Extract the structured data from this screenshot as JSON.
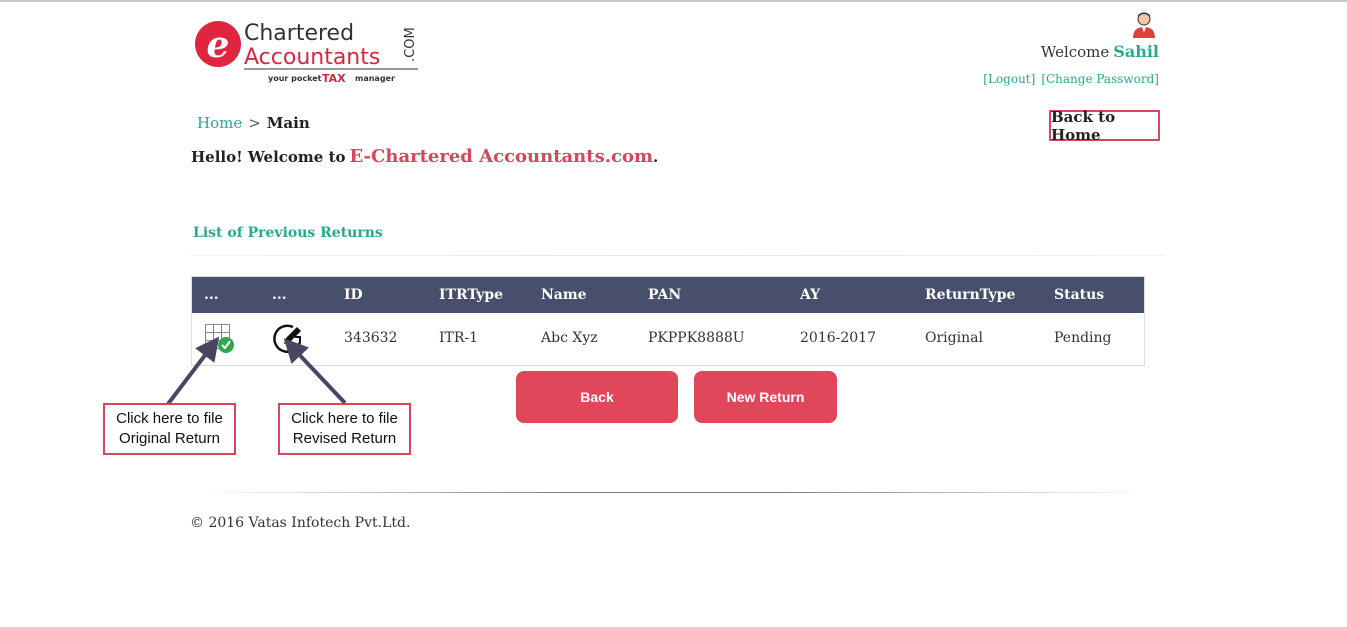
{
  "logo": {
    "letter": "e",
    "line1": "Chartered",
    "line2": "Accountants",
    "dot_com": ".COM",
    "tagline_pre": "your pocket",
    "tagline_tax": "TAX",
    "tagline_post": "manager"
  },
  "user": {
    "welcome_label": "Welcome",
    "name": "Sahil",
    "logout": "[Logout]",
    "change_password": "[Change Password]"
  },
  "breadcrumb": {
    "home": "Home",
    "separator": ">",
    "current": "Main"
  },
  "back_to_home": "Back to Home",
  "hello": {
    "text": "Hello! Welcome to",
    "brand": "E-Chartered Accountants.com",
    "suffix": "."
  },
  "list_title": "List of Previous Returns",
  "table": {
    "headers": [
      "...",
      "...",
      "ID",
      "ITRType",
      "Name",
      "PAN",
      "AY",
      "ReturnType",
      "Status"
    ],
    "rows": [
      {
        "id": "343632",
        "itr_type": "ITR-1",
        "name": "Abc Xyz",
        "pan": "PKPPK8888U",
        "ay": "2016-2017",
        "return_type": "Original",
        "status": "Pending"
      }
    ]
  },
  "buttons": {
    "back": "Back",
    "new_return": "New Return"
  },
  "callouts": {
    "original": [
      "Click here to file",
      "Original Return"
    ],
    "revised": [
      "Click here to file",
      "Revised Return"
    ]
  },
  "footer": "© 2016 Vatas Infotech Pvt.Ltd.",
  "colors": {
    "accent_red": "#e0475a",
    "teal": "#2aa890",
    "table_header": "#484f6c"
  },
  "icons": {
    "original": "grid-check-icon",
    "revised": "edit-circle-icon",
    "user": "user-avatar-icon"
  }
}
